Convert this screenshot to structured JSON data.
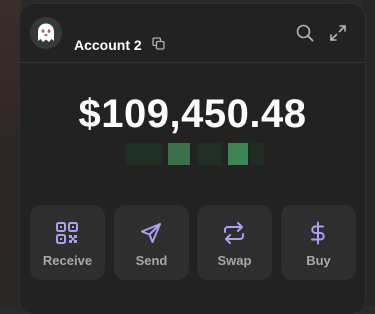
{
  "account": {
    "name": "Account 2",
    "avatar": "ghost-avatar-icon"
  },
  "header": {
    "copy_icon": "copy-icon",
    "search_icon": "search-icon",
    "expand_icon": "expand-icon"
  },
  "balance": {
    "total": "$109,450.48"
  },
  "actions": [
    {
      "label": "Receive",
      "icon": "qr-code-icon"
    },
    {
      "label": "Send",
      "icon": "send-icon"
    },
    {
      "label": "Swap",
      "icon": "swap-icon"
    },
    {
      "label": "Buy",
      "icon": "dollar-icon"
    }
  ],
  "colors": {
    "accent": "#ab9ff2",
    "background": "#222222",
    "button": "#2e2e2e",
    "text_primary": "#ffffff",
    "text_secondary": "#a8a8a8",
    "blurred_green": "#3a7a4f"
  }
}
